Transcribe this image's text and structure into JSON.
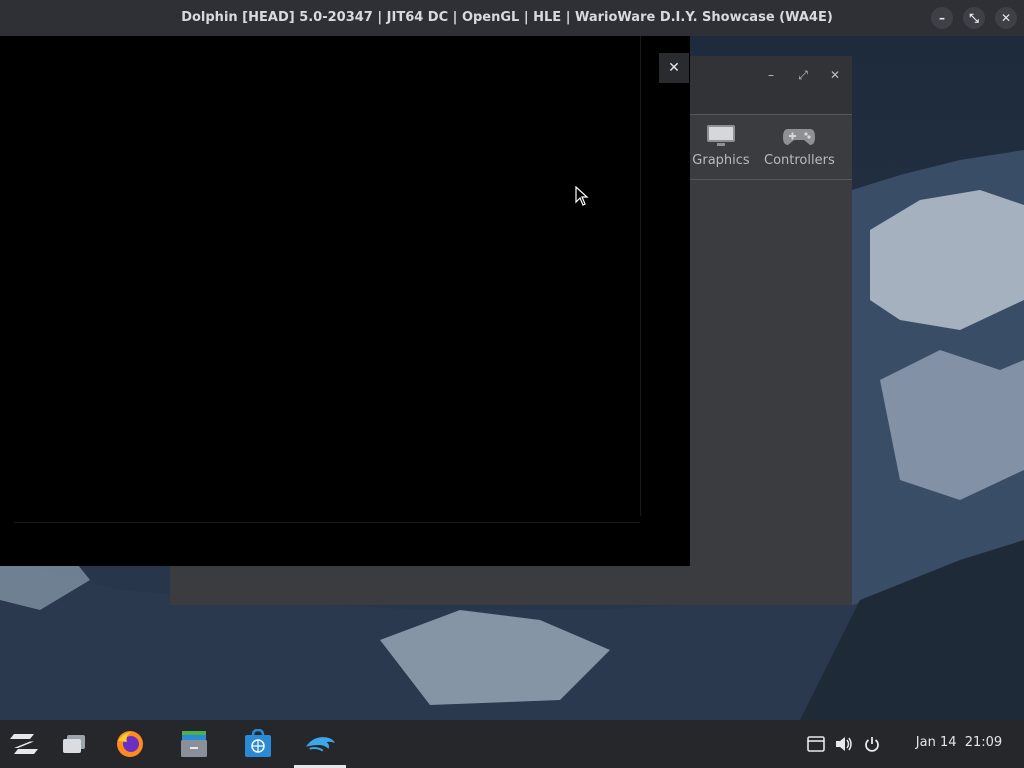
{
  "window": {
    "title": "Dolphin [HEAD] 5.0-20347 | JIT64 DC | OpenGL | HLE | WarioWare D.I.Y. Showcase (WA4E)",
    "minimize_glyph": "–",
    "restore_glyph": "⤡",
    "close_glyph": "✕"
  },
  "settings_dialog": {
    "tools": [
      {
        "label": "Graphics",
        "icon": "monitor-icon"
      },
      {
        "label": "Controllers",
        "icon": "gamepad-icon"
      }
    ],
    "minimize_glyph": "–",
    "maximize_glyph": "⤢",
    "close_glyph": "✕",
    "float_close_glyph": "✕"
  },
  "taskbar": {
    "apps": [
      {
        "name": "zorin-menu",
        "icon": "zorin-logo-icon"
      },
      {
        "name": "workspaces",
        "icon": "windows-stack-icon"
      },
      {
        "name": "firefox",
        "icon": "firefox-icon"
      },
      {
        "name": "files",
        "icon": "file-cabinet-icon"
      },
      {
        "name": "software",
        "icon": "software-store-icon"
      },
      {
        "name": "dolphin",
        "icon": "dolphin-icon"
      }
    ],
    "tray": [
      "notes-icon",
      "volume-icon",
      "power-icon"
    ],
    "clock": "Jan 14  21:09"
  },
  "colors": {
    "taskbar_bg": "#25272b",
    "titlebar_bg": "#2e3035",
    "dialog_bg": "#3b3c3f",
    "accent_blue": "#2b8ad6"
  }
}
